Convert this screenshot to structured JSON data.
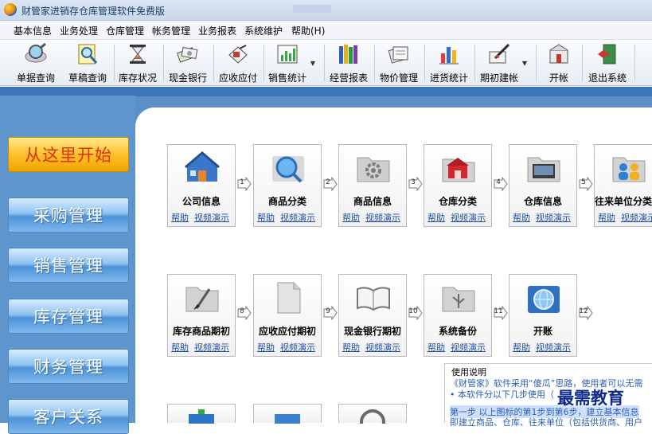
{
  "window": {
    "title": "财管家进销存仓库管理软件免费版"
  },
  "menu": [
    "基本信息",
    "业务处理",
    "仓库管理",
    "帐务管理",
    "业务报表",
    "系统维护",
    "帮助(H)"
  ],
  "toolbar": [
    {
      "label": "单据查询",
      "icon": "magnifier-document-icon"
    },
    {
      "label": "草稿查询",
      "icon": "draft-magnifier-icon"
    },
    {
      "label": "库存状况",
      "icon": "hourglass-icon"
    },
    {
      "label": "现金银行",
      "icon": "cash-bank-icon"
    },
    {
      "label": "应收应付",
      "icon": "receivable-payable-icon"
    },
    {
      "label": "销售统计",
      "icon": "bar-chart-icon",
      "dropdown": true
    },
    {
      "label": "经营报表",
      "icon": "books-icon"
    },
    {
      "label": "物价管理",
      "icon": "price-docs-icon"
    },
    {
      "label": "进货统计",
      "icon": "purchase-chart-icon"
    },
    {
      "label": "期初建帐",
      "icon": "pen-ledger-icon",
      "dropdown": true
    },
    {
      "label": "开帐",
      "icon": "open-account-icon"
    },
    {
      "label": "退出系统",
      "icon": "exit-door-icon"
    }
  ],
  "sidebar": [
    {
      "label": "从这里开始",
      "style": "start"
    },
    {
      "label": "采购管理",
      "style": "blue"
    },
    {
      "label": "销售管理",
      "style": "blue"
    },
    {
      "label": "库存管理",
      "style": "blue"
    },
    {
      "label": "财务管理",
      "style": "blue"
    },
    {
      "label": "客户关系",
      "style": "blue"
    }
  ],
  "links": {
    "help": "帮助",
    "video": "视频演示"
  },
  "cards_row1": [
    {
      "label": "公司信息",
      "icon": "company-house-icon",
      "step": "1"
    },
    {
      "label": "商品分类",
      "icon": "globe-search-icon",
      "step": "2"
    },
    {
      "label": "商品信息",
      "icon": "gear-folder-icon",
      "step": "3"
    },
    {
      "label": "仓库分类",
      "icon": "warehouse-folder-icon",
      "step": "4"
    },
    {
      "label": "仓库信息",
      "icon": "window-folder-icon",
      "step": "5"
    },
    {
      "label": "往来单位分类",
      "icon": "people-folder-icon",
      "step": ""
    }
  ],
  "cards_row2": [
    {
      "label": "库存商品期初",
      "icon": "brush-folder-icon",
      "step": "8"
    },
    {
      "label": "应收应付期初",
      "icon": "blank-doc-icon",
      "step": "9"
    },
    {
      "label": "现金银行期初",
      "icon": "open-book-icon",
      "step": "10"
    },
    {
      "label": "系统备份",
      "icon": "usb-folder-icon",
      "step": "11"
    },
    {
      "label": "开账",
      "icon": "network-globe-icon",
      "step": "12"
    }
  ],
  "usage": {
    "title": "使用说明",
    "line1": "《财管家》软件采用“傻瓜”思路，使用者可以无需",
    "line2": "• 本软件分以下几步使用（",
    "line3": "第一步 以上图标的第1步到第6步，建立基本信息",
    "line4": "即建立商品、仓库、往来单位（包括供货商、用户"
  },
  "watermark": "最需教育"
}
